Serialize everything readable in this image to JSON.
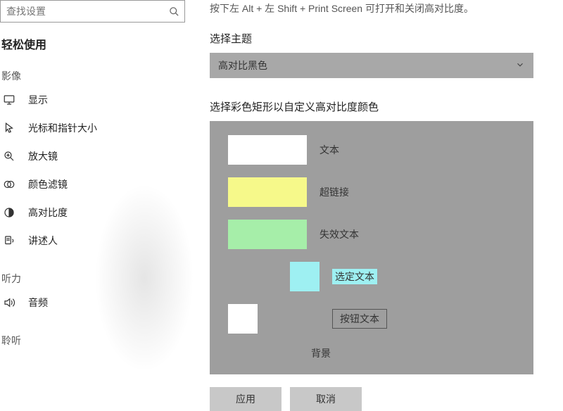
{
  "search": {
    "placeholder": "查找设置"
  },
  "sidebar": {
    "section": "轻松使用",
    "cat_vision": "影像",
    "cat_hearing": "听力",
    "cat_other": "聆听",
    "items": {
      "display": "显示",
      "cursor": "光标和指针大小",
      "magnifier": "放大镜",
      "color_filters": "颜色滤镜",
      "high_contrast": "高对比度",
      "narrator": "讲述人",
      "audio": "音频"
    }
  },
  "content": {
    "hint": "按下左 Alt + 左 Shift + Print Screen 可打开和关闭高对比度。",
    "select_theme": "选择主题",
    "theme_value": "高对比黑色",
    "select_rect": "选择彩色矩形以自定义高对比度颜色",
    "labels": {
      "text": "文本",
      "hyperlink": "超链接",
      "disabled": "失效文本",
      "selected": "选定文本",
      "button": "按钮文本",
      "background": "背景"
    },
    "swatches": {
      "text": "#ffffff",
      "hyperlink": "#f6f98a",
      "disabled": "#a6eea9",
      "selected": "#9ef0f2",
      "button_bg": "#ffffff"
    },
    "apply": "应用",
    "cancel": "取消"
  }
}
